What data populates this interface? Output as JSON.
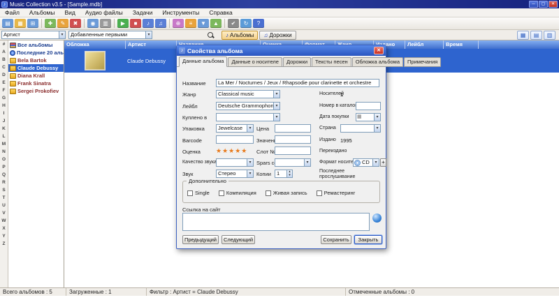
{
  "window": {
    "title": "Music Collection v3.5 - [Sample.mdb]",
    "controls": {
      "minimize": "─",
      "maximize": "▢",
      "close": "✕"
    }
  },
  "menu": {
    "items": [
      "Файл",
      "Альбомы",
      "Вид",
      "Аудио файлы",
      "Задачи",
      "Инструменты",
      "Справка"
    ]
  },
  "toolbar": {
    "icons": [
      {
        "name": "new-collection-icon",
        "glyph": "▤",
        "color": "#6b9bd8"
      },
      {
        "name": "open-collection-icon",
        "glyph": "▦",
        "color": "#e8b84a"
      },
      {
        "name": "save-collection-icon",
        "glyph": "⊞",
        "color": "#6b9bd8"
      },
      {
        "sep": true
      },
      {
        "name": "add-album-icon",
        "glyph": "✚",
        "color": "#7cb85c"
      },
      {
        "name": "edit-album-icon",
        "glyph": "✎",
        "color": "#e8a33d"
      },
      {
        "name": "delete-album-icon",
        "glyph": "✖",
        "color": "#d05050"
      },
      {
        "sep": true
      },
      {
        "name": "search-albums-icon",
        "glyph": "◉",
        "color": "#6b9bd8"
      },
      {
        "name": "print-icon",
        "glyph": "▥",
        "color": "#9a9a9a"
      },
      {
        "sep": true
      },
      {
        "name": "play-icon",
        "glyph": "▶",
        "color": "#4caf50"
      },
      {
        "name": "stop-icon",
        "glyph": "■",
        "color": "#d05050"
      },
      {
        "name": "audio-files-icon",
        "glyph": "♪",
        "color": "#5b7fd6"
      },
      {
        "name": "playlist-icon",
        "glyph": "♫",
        "color": "#5b7fd6"
      },
      {
        "sep": true
      },
      {
        "name": "loans-icon",
        "glyph": "⊕",
        "color": "#c878c8"
      },
      {
        "name": "statistics-icon",
        "glyph": "≡",
        "color": "#e8a33d"
      },
      {
        "name": "reports-icon",
        "glyph": "▼",
        "color": "#6b9bd8"
      },
      {
        "name": "export-icon",
        "glyph": "▲",
        "color": "#7cb85c"
      },
      {
        "sep": true
      },
      {
        "name": "settings-icon",
        "glyph": "✔",
        "color": "#8a8a8a"
      },
      {
        "name": "update-icon",
        "glyph": "↻",
        "color": "#5b9bd8"
      },
      {
        "name": "help-icon",
        "glyph": "?",
        "color": "#4a6fd0"
      }
    ]
  },
  "filterbar": {
    "field_value": "Артист",
    "sort_value": "Добавленные первыми",
    "albums_label": "Альбомы",
    "tracks_label": "Дорожки"
  },
  "alphabet": [
    "#",
    "A",
    "B",
    "C",
    "D",
    "E",
    "F",
    "G",
    "H",
    "I",
    "J",
    "K",
    "L",
    "M",
    "N",
    "O",
    "P",
    "Q",
    "R",
    "S",
    "T",
    "U",
    "V",
    "W",
    "X",
    "Y",
    "Z"
  ],
  "sidebar": {
    "items": [
      {
        "label": "Все альбомы",
        "icon": "all",
        "color": "blue"
      },
      {
        "label": "Последние 20 альб...",
        "icon": "recent",
        "color": "blue"
      },
      {
        "label": "Bela Bartok",
        "icon": "folder",
        "color": "maroon"
      },
      {
        "label": "Claude Debussy",
        "icon": "folder",
        "color": "maroon",
        "selected": true
      },
      {
        "label": "Diana Krall",
        "icon": "folder",
        "color": "maroon"
      },
      {
        "label": "Frank Sinatra",
        "icon": "folder",
        "color": "maroon"
      },
      {
        "label": "Sergei Prokofiev",
        "icon": "folder",
        "color": "maroon"
      }
    ]
  },
  "table": {
    "columns": [
      "Обложка",
      "Артист",
      "Название",
      "Оценка",
      "Формат",
      "Жанр",
      "Издано",
      "Лейбл",
      "Время"
    ],
    "row": {
      "artist": "Claude Debussy",
      "title": "La Mer / Nocturnes / Jeux / Rhapsodie pour clarinette et orchestre"
    }
  },
  "dialog": {
    "title": "Свойства альбома",
    "close_glyph": "✕",
    "tabs": [
      {
        "label": "Данные альбома",
        "active": true
      },
      {
        "label": "Данные о носителе"
      },
      {
        "label": "Дорожки"
      },
      {
        "label": "Тексты песен"
      },
      {
        "label": "Обложка альбома"
      },
      {
        "label": "Примечания"
      }
    ],
    "fields": {
      "title": {
        "label": "Название",
        "value": "La Mer / Nocturnes / Jeux / Rhapsodie pour clarinette et orchestre"
      },
      "genre": {
        "label": "Жанр",
        "value": "Classical music"
      },
      "media_count": {
        "label": "Носителей",
        "value": "1"
      },
      "label": {
        "label": "Лейбл",
        "value": "Deutsche Grammophon"
      },
      "catalog_number": {
        "label": "Номер в каталоге",
        "value": ""
      },
      "purchased_at": {
        "label": "Куплено в",
        "value": ""
      },
      "purchase_date": {
        "label": "Дата покупки",
        "value": ""
      },
      "packaging": {
        "label": "Упаковка",
        "value": "Jewelcase"
      },
      "price": {
        "label": "Цена",
        "value": ""
      },
      "country": {
        "label": "Страна",
        "value": ""
      },
      "barcode": {
        "label": "Barcode",
        "value": ""
      },
      "barcode_value": {
        "label": "Значение",
        "value": ""
      },
      "released": {
        "label": "Издано",
        "value": "1995"
      },
      "rating": {
        "label": "Оценка",
        "stars": "★★★★★"
      },
      "slot": {
        "label": "Слот №",
        "value": ""
      },
      "reissued": {
        "label": "Переиздано",
        "value": ""
      },
      "sound_quality": {
        "label": "Качество звука",
        "value": ""
      },
      "spars_code": {
        "label": "Spars code",
        "value": ""
      },
      "media_format": {
        "label": "Формат носителя",
        "value": "CD",
        "add_label": "+"
      },
      "sound": {
        "label": "Звук",
        "value": "Стерео"
      },
      "copies": {
        "label": "Копии",
        "value": "1"
      },
      "last_played": {
        "label": "Последнее прослушивание",
        "value": ""
      }
    },
    "extras": {
      "label": "Дополнительно",
      "options": [
        "Single",
        "Компиляция",
        "Живая запись",
        "Ремастеринг"
      ]
    },
    "website": {
      "label": "Ссылка на сайт"
    },
    "buttons": {
      "prev": "Предыдущий",
      "next": "Следующий",
      "save": "Сохранить",
      "close": "Закрыть"
    }
  },
  "statusbar": {
    "total": "Всего альбомов : 5",
    "loaded": "Загруженные : 1",
    "filter": "Фильтр : Артист = Claude Debussy",
    "checked": "Отмеченные альбомы : 0"
  },
  "colors": {
    "selection": "#2e64cf",
    "header_top": "#85aff0",
    "header_bottom": "#3f6fce"
  }
}
